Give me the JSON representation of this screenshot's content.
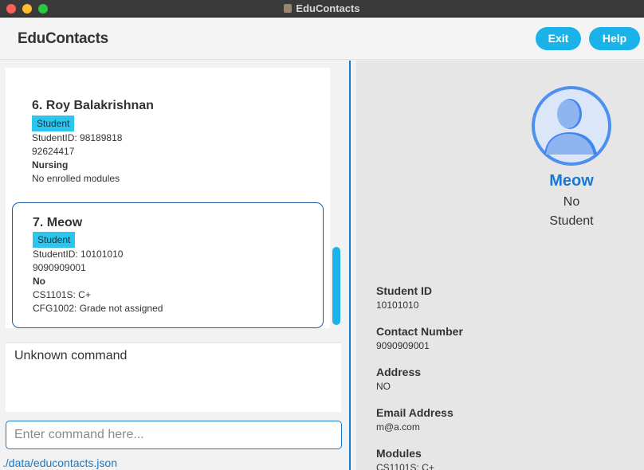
{
  "window": {
    "title": "EduContacts"
  },
  "header": {
    "brand": "EduContacts",
    "exit_label": "Exit",
    "help_label": "Help"
  },
  "contacts": [
    {
      "name": "6. Roy Balakrishnan",
      "role": "Student",
      "student_id": "StudentID: 98189818",
      "phone": "92624417",
      "course": "Nursing",
      "modules": [
        "No enrolled modules"
      ]
    },
    {
      "name": "7. Meow",
      "role": "Student",
      "student_id": "StudentID: 10101010",
      "phone": "9090909001",
      "course": "No",
      "modules": [
        "CS1101S: C+",
        "CFG1002: Grade not assigned"
      ]
    }
  ],
  "result": {
    "text": "Unknown command"
  },
  "command": {
    "placeholder": "Enter command here..."
  },
  "status": {
    "path": "./data/educontacts.json"
  },
  "details": {
    "name": "Meow",
    "course": "No",
    "role": "Student",
    "fields": [
      {
        "label": "Student ID",
        "value": "10101010"
      },
      {
        "label": "Contact Number",
        "value": "9090909001"
      },
      {
        "label": "Address",
        "value": "NO"
      },
      {
        "label": "Email Address",
        "value": "m@a.com"
      },
      {
        "label": "Modules",
        "value": "CS1101S: C+"
      }
    ]
  },
  "colors": {
    "accent": "#1ab2e8",
    "badge": "#2bc6ee",
    "selection_border": "#1d5ca0",
    "name_blue": "#1a78d4"
  },
  "icons": [
    "app-icon",
    "person-avatar-icon"
  ]
}
